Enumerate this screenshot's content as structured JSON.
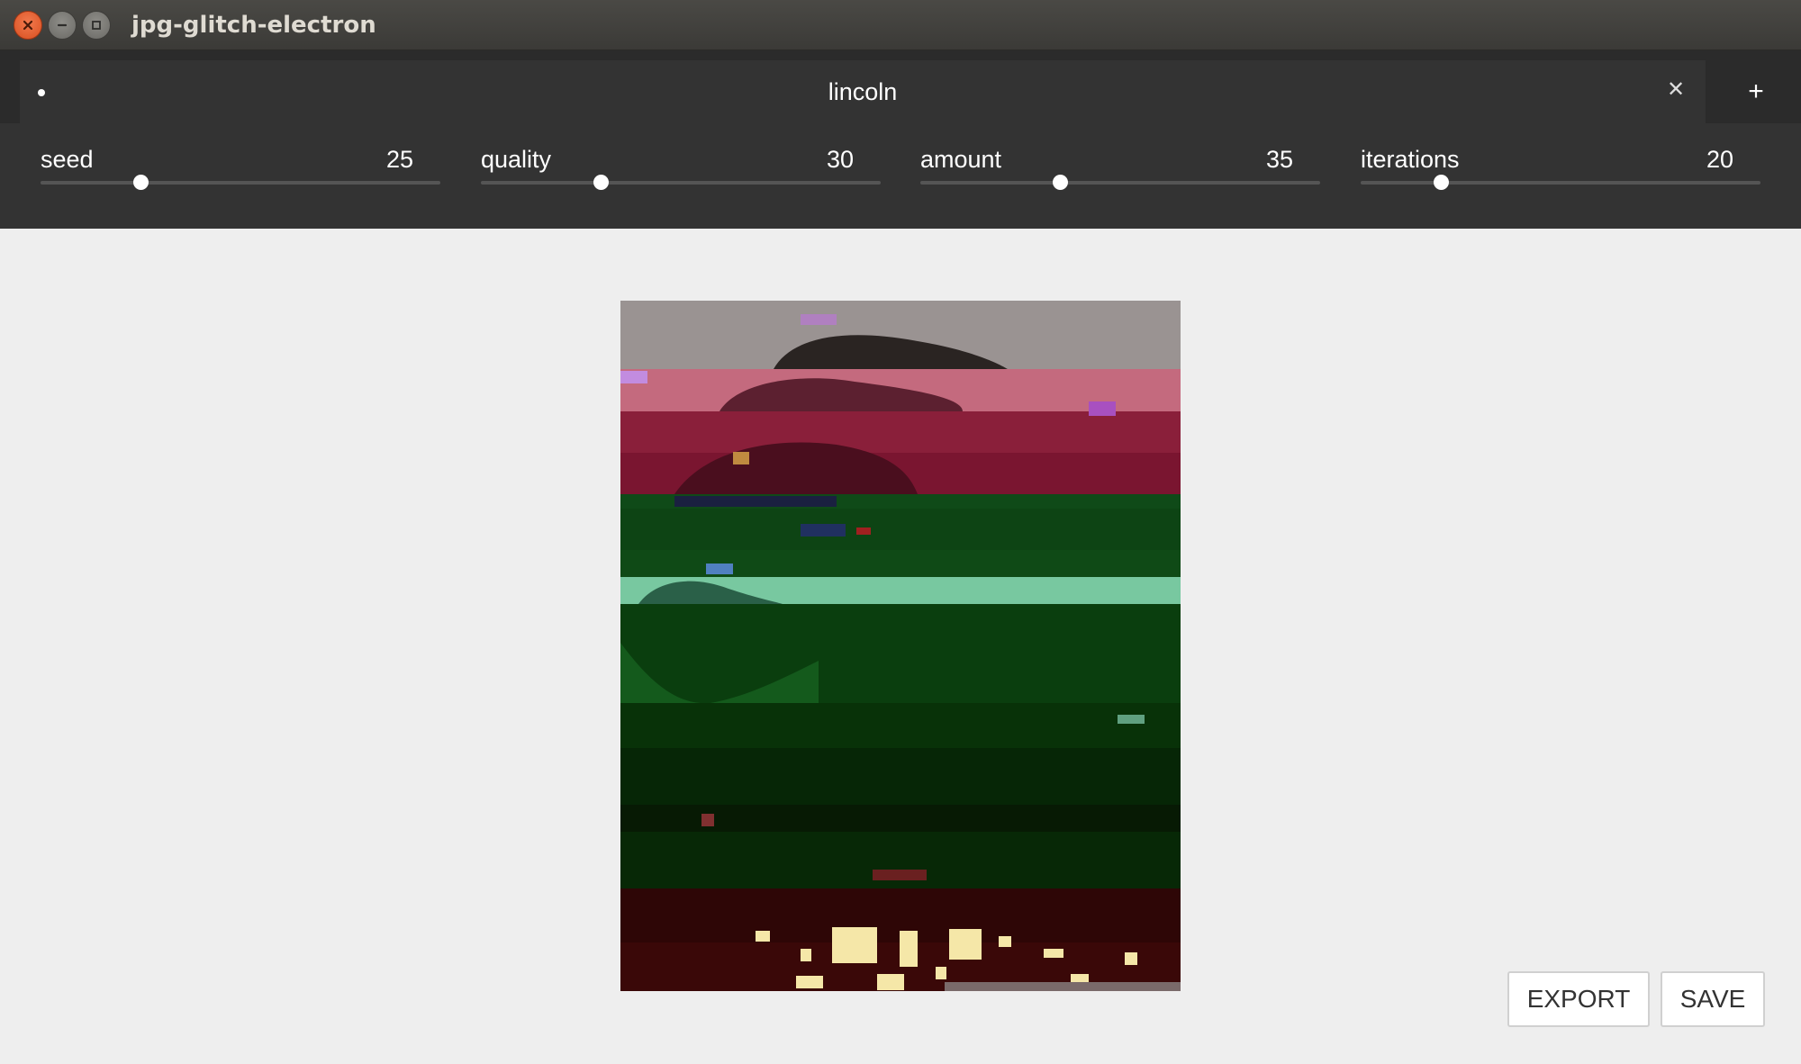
{
  "window": {
    "title": "jpg-glitch-electron",
    "controls": [
      "close-icon",
      "minimize-icon",
      "maximize-icon"
    ]
  },
  "tabs": [
    {
      "label": "lincoln",
      "active": true,
      "modified_indicator": "dot-icon",
      "close_icon": "close-icon"
    }
  ],
  "add_tab_icon": "plus-icon",
  "sliders": [
    {
      "label": "seed",
      "value": "25",
      "fraction": 0.25
    },
    {
      "label": "quality",
      "value": "30",
      "fraction": 0.3
    },
    {
      "label": "amount",
      "value": "35",
      "fraction": 0.35
    },
    {
      "label": "iterations",
      "value": "20",
      "fraction": 0.2
    }
  ],
  "actions": {
    "export_label": "EXPORT",
    "save_label": "SAVE"
  },
  "colors": {
    "accent_close": "#e95420",
    "toolbar_bg": "#333333",
    "canvas_bg": "#eeeeee"
  }
}
